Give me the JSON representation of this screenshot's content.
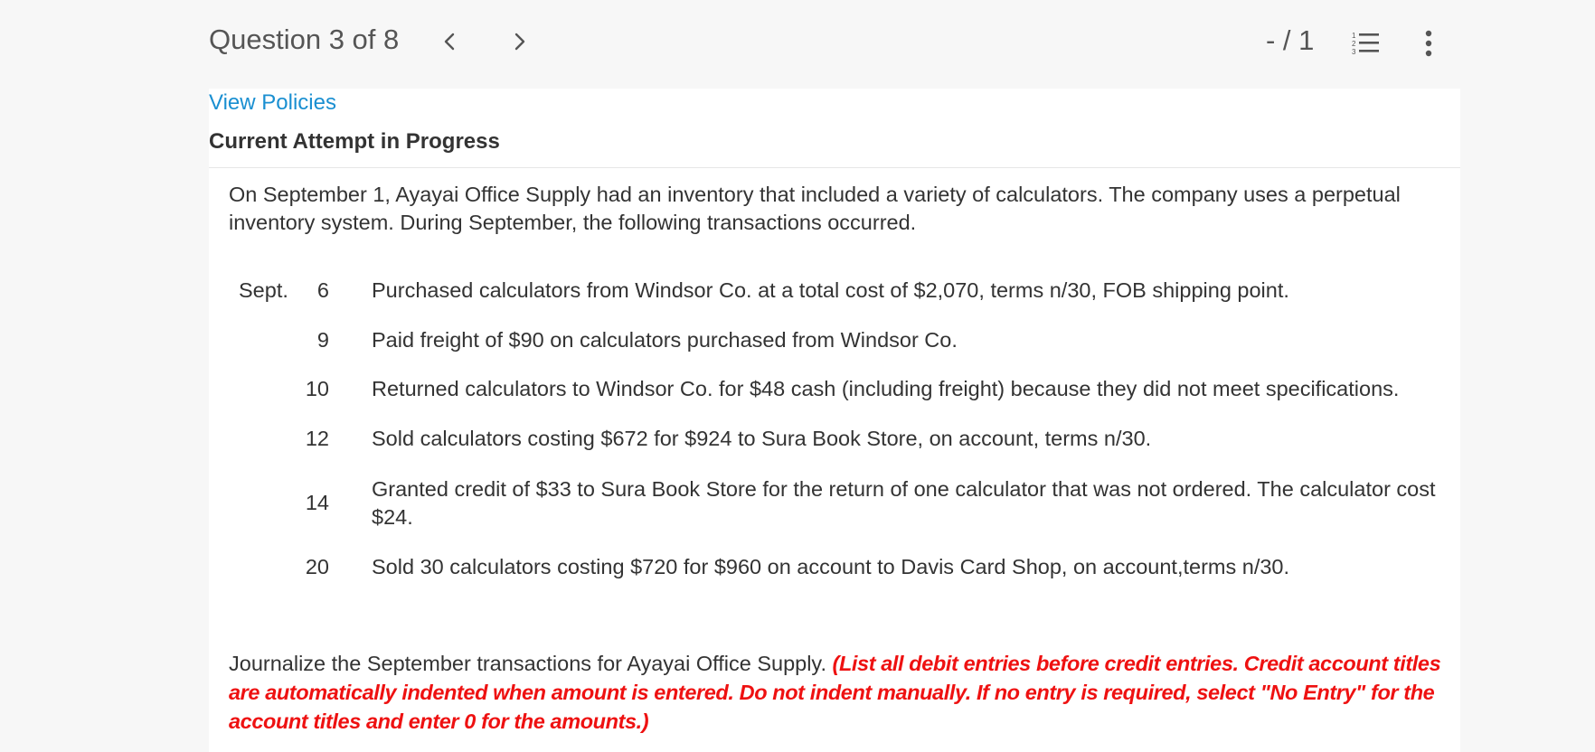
{
  "header": {
    "question_label": "Question 3 of 8",
    "prev_icon": "chevron-left-icon",
    "next_icon": "chevron-right-icon",
    "score": "- / 1",
    "list_icon": "numbered-list-icon",
    "more_icon": "vertical-dots-icon"
  },
  "view_policies": "View Policies",
  "attempt_heading": "Current Attempt in Progress",
  "intro": "On September 1, Ayayai Office Supply had an inventory that included a variety of calculators. The company uses a perpetual inventory system. During September, the following transactions occurred.",
  "transactions": {
    "month": "Sept.",
    "items": [
      {
        "day": "6",
        "desc": "Purchased calculators from Windsor Co. at a total cost of $2,070, terms n/30, FOB shipping point."
      },
      {
        "day": "9",
        "desc": "Paid freight of $90 on calculators purchased from Windsor Co."
      },
      {
        "day": "10",
        "desc": "Returned calculators to Windsor Co. for $48 cash (including freight) because they did not meet specifications."
      },
      {
        "day": "12",
        "desc": "Sold calculators costing $672 for $924 to Sura Book Store, on account, terms n/30."
      },
      {
        "day": "14",
        "desc": "Granted credit of $33 to Sura Book Store for the return of one calculator that was not ordered. The calculator cost $24."
      },
      {
        "day": "20",
        "desc": "Sold 30 calculators costing $720 for $960 on account to Davis Card Shop, on account,terms n/30."
      }
    ]
  },
  "journal": {
    "prompt": "Journalize the September transactions for Ayayai Office Supply.",
    "instructions": "(List all debit entries before credit entries. Credit account titles are automatically indented when amount is entered. Do not indent manually. If no entry is required, select \"No Entry\" for the account titles and enter 0 for the amounts.)"
  },
  "colors": {
    "link": "#1a8fd1",
    "instruction": "#ee1111"
  }
}
